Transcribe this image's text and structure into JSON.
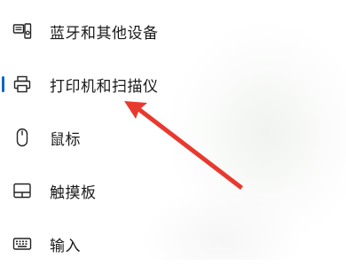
{
  "nav": {
    "items": [
      {
        "label": "蓝牙和其他设备",
        "icon": "bluetooth-devices-icon"
      },
      {
        "label": "打印机和扫描仪",
        "icon": "printer-icon",
        "selected": true
      },
      {
        "label": "鼠标",
        "icon": "mouse-icon"
      },
      {
        "label": "触摸板",
        "icon": "touchpad-icon"
      },
      {
        "label": "输入",
        "icon": "keyboard-icon"
      }
    ]
  },
  "colors": {
    "accent": "#0067c0",
    "annotation_arrow": "#e8392f",
    "text": "#1a1a1a"
  }
}
